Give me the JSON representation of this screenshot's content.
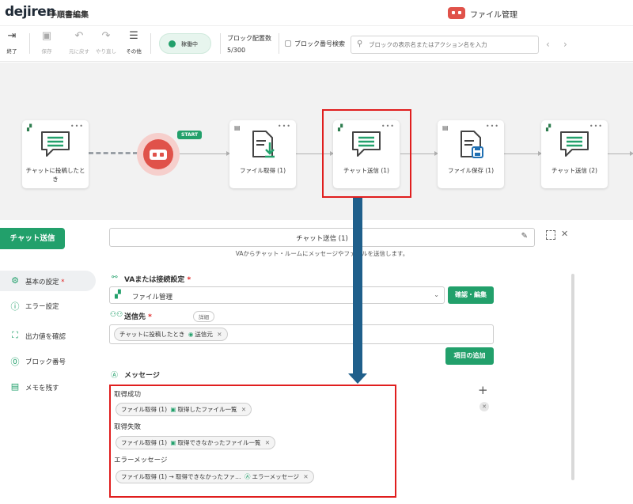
{
  "header": {
    "logo": "dejiren",
    "title": "手順書編集",
    "va_name": "ファイル管理"
  },
  "toolbar": {
    "exit": "終了",
    "save": "保存",
    "undo": "元に戻す",
    "redo": "やり直し",
    "other": "その他",
    "status": "稼働中",
    "block_label": "ブロック配置数",
    "block_count": "5/300",
    "block_number_search": "ブロック番号検索",
    "search_placeholder": "ブロックの表示名またはアクション名を入力"
  },
  "canvas": {
    "start": "START",
    "nodes": [
      {
        "label": "チャットに投稿したとき",
        "type": "trigger"
      },
      {
        "label": "ファイル取得 (1)",
        "type": "file-get"
      },
      {
        "label": "チャット送信 (1)",
        "type": "chat",
        "highlighted": true
      },
      {
        "label": "ファイル保存 (1)",
        "type": "file-save"
      },
      {
        "label": "チャット送信 (2)",
        "type": "chat"
      }
    ]
  },
  "left": {
    "chat_send": "チャット送信",
    "nav": [
      {
        "label": "基本の設定",
        "required": "*",
        "icon": "gear-icon",
        "active": true
      },
      {
        "label": "エラー設定",
        "icon": "error-icon"
      },
      {
        "label": "出力値を確認",
        "icon": "output-icon"
      },
      {
        "label": "ブロック番号",
        "icon": "id-icon"
      },
      {
        "label": "メモを残す",
        "icon": "memo-icon"
      }
    ]
  },
  "panel": {
    "title": "チャット送信 (1)",
    "description": "VAからチャット・ルームにメッセージやファイルを送信します。",
    "va_label": "VAまたは接続設定",
    "req": "*",
    "va_value": "ファイル管理",
    "confirm_edit": "確認・編集",
    "dest_label": "送信先",
    "detail": "詳細",
    "dest_chip_prefix": "チャットに投稿したとき",
    "dest_chip_value": "送信元",
    "add_item": "項目の追加",
    "message_label": "メッセージ",
    "rows": [
      {
        "label": "取得成功",
        "chip_prefix": "ファイル取得 (1)",
        "chip_value": "取得したファイル一覧"
      },
      {
        "label": "取得失敗",
        "chip_prefix": "ファイル取得 (1)",
        "chip_value": "取得できなかったファイル一覧"
      },
      {
        "label": "エラーメッセージ",
        "chip_prefix": "ファイル取得 (1) → 取得できなかったファ…",
        "chip_value": "エラーメッセージ"
      }
    ]
  },
  "colors": {
    "accent": "#22a06b",
    "highlight": "#e01e1e",
    "arrow": "#1f5f8b",
    "robot": "#e0524a"
  }
}
